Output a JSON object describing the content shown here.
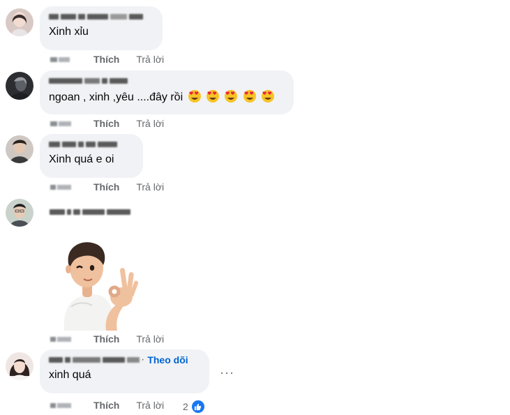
{
  "actions": {
    "like_label": "Thích",
    "reply_label": "Trả lời"
  },
  "comments": [
    {
      "text": "Xinh xỉu"
    },
    {
      "text": "ngoan , xinh ,yêu ....đây rồi",
      "emoji": "heart-eyes-emoji"
    },
    {
      "text": "Xinh quá e oi"
    },
    {
      "sticker": "boy-ok-hand-sticker"
    },
    {
      "text": "xinh quá",
      "follow_label": "Theo dõi",
      "reaction_count": "2",
      "reaction_icon": "like-icon"
    }
  ],
  "more_label": "···",
  "colors": {
    "bubble": "#f0f2f5",
    "link": "#0064d1",
    "like": "#1877f2",
    "meta": "#65676b"
  }
}
